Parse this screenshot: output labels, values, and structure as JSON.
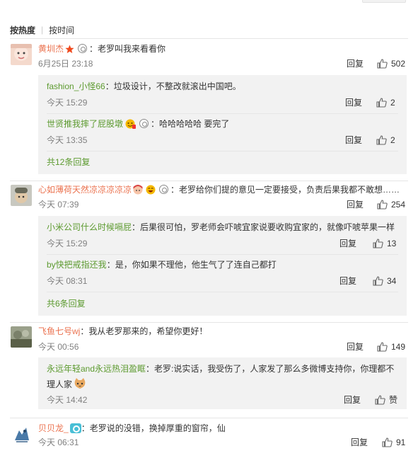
{
  "sort": {
    "hot": "按热度",
    "time": "按时间"
  },
  "comments": [
    {
      "user": "黄圳杰",
      "text": "：老罗叫我来看看你",
      "time": "6月25日 23:18",
      "reply": "回复",
      "likes": "502",
      "replies": [
        {
          "user": "fashion_小怪66",
          "text": "：垃圾设计，不整改就滚出中国吧。",
          "time": "今天 15:29",
          "reply": "回复",
          "likes": "2"
        },
        {
          "user": "世贤推我摔了屁股墩",
          "text": "：哈哈哈哈哈 要完了",
          "time": "今天 13:35",
          "reply": "回复",
          "likes": "2"
        }
      ],
      "more": "共12条回复"
    },
    {
      "user": "心如薄荷天然凉凉凉凉凉",
      "text": "：老罗给你们提的意见一定要接受，负责后果我都不敢想……",
      "time": "今天 07:39",
      "reply": "回复",
      "likes": "254",
      "replies": [
        {
          "user": "小米公司什么时候嗝屁",
          "text": "：后果很可怕，罗老师会吓唬宜家说要收购宜家的，就像吓唬苹果一样",
          "time": "今天 15:29",
          "reply": "回复",
          "likes": "13"
        },
        {
          "user": "by快把戒指还我",
          "text": "：是，你如果不理他，他生气了了连自己都打",
          "time": "今天 08:31",
          "reply": "回复",
          "likes": "34"
        }
      ],
      "more": "共6条回复"
    },
    {
      "user": "飞鱼七号wj",
      "text": "：我从老罗那来的，希望你更好！",
      "time": "今天 00:56",
      "reply": "回复",
      "likes": "149",
      "replies": [
        {
          "user": "永远年轻and永远热泪盈眶",
          "text": "：老罗:说实话，我受伤了，人家发了那么多微博支持你，你理都不",
          "text2": "理人家",
          "time": "今天 14:42",
          "reply": "回复",
          "likes": "赞"
        }
      ]
    },
    {
      "user": "贝贝龙_",
      "text": "：老罗说的没错，换掉厚重的窗帘，仙",
      "time": "今天 06:31",
      "reply": "回复",
      "likes": "91"
    }
  ],
  "colors": {
    "username": "#eb7350",
    "subname": "#5c9a2f",
    "meta": "#808080",
    "box": "#f2f2f2"
  }
}
